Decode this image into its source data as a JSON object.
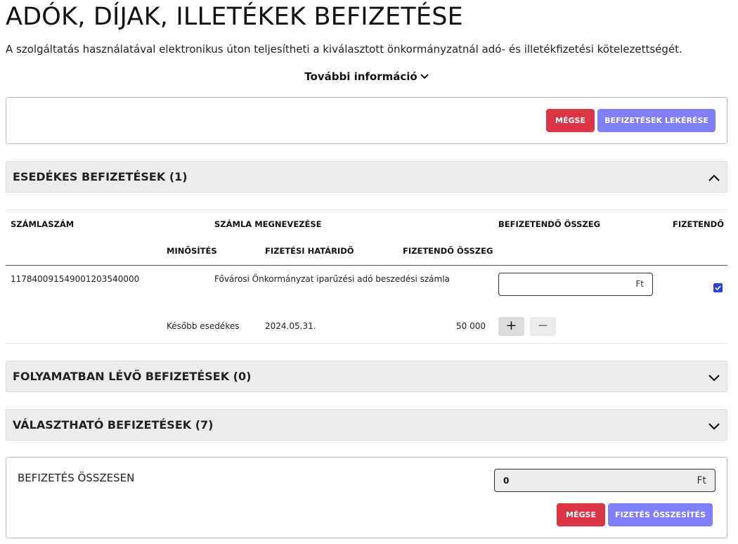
{
  "page": {
    "title": "ADÓK, DÍJAK, ILLETÉKEK BEFIZETÉSE",
    "subtitle": "A szolgáltatás használatával elektronikus úton teljesítheti a kiválasztott önkormányzatnál adó- és illetékfizetési kötelezettségét.",
    "more_info": "További információ"
  },
  "top_actions": {
    "cancel_label": "MÉGSE",
    "fetch_label": "BEFIZETÉSEK LEKÉRÉSE"
  },
  "sections": {
    "due": {
      "label": "ESEDÉKES BEFIZETÉSEK (1)",
      "expanded": true
    },
    "in_progress": {
      "label": "FOLYAMATBAN LÉVŐ BEFIZETÉSEK (0)",
      "expanded": false
    },
    "selectable": {
      "label": "VÁLASZTHATÓ BEFIZETÉSEK (7)",
      "expanded": false
    }
  },
  "due_table": {
    "headers": {
      "account_number": "SZÁMLASZÁM",
      "account_name": "SZÁMLA MEGNEVEZÉSE",
      "amount_to_pay": "BEFIZETENDŐ ÖSSZEG",
      "payable": "FIZETENDŐ",
      "classification": "MINŐSÍTÉS",
      "deadline": "FIZETÉSI HATÁRIDŐ",
      "payable_amount": "FIZETENDŐ ÖSSZEG"
    },
    "rows": [
      {
        "account_number": "11784009154900120354000​0",
        "account_name": "Fővárosi Önkormányzat iparűzési adó beszedési számla",
        "amount_value": "",
        "amount_unit": "Ft",
        "payable_checked": true,
        "classification": "Később esedékes",
        "deadline": "2024.05.31.",
        "payable_amount": "50 000",
        "plus_label": "+",
        "minus_label": "−"
      }
    ]
  },
  "total": {
    "label": "BEFIZETÉS ÖSSZESEN",
    "value": "0",
    "unit": "Ft",
    "cancel_label": "MÉGSE",
    "summary_label": "FIZETÉS ÖSSZESÍTÉS"
  },
  "colors": {
    "danger": "#dc3545",
    "primary": "#7f7fff",
    "checkbox": "#2a45d6",
    "accordion_bg": "#ececec"
  }
}
